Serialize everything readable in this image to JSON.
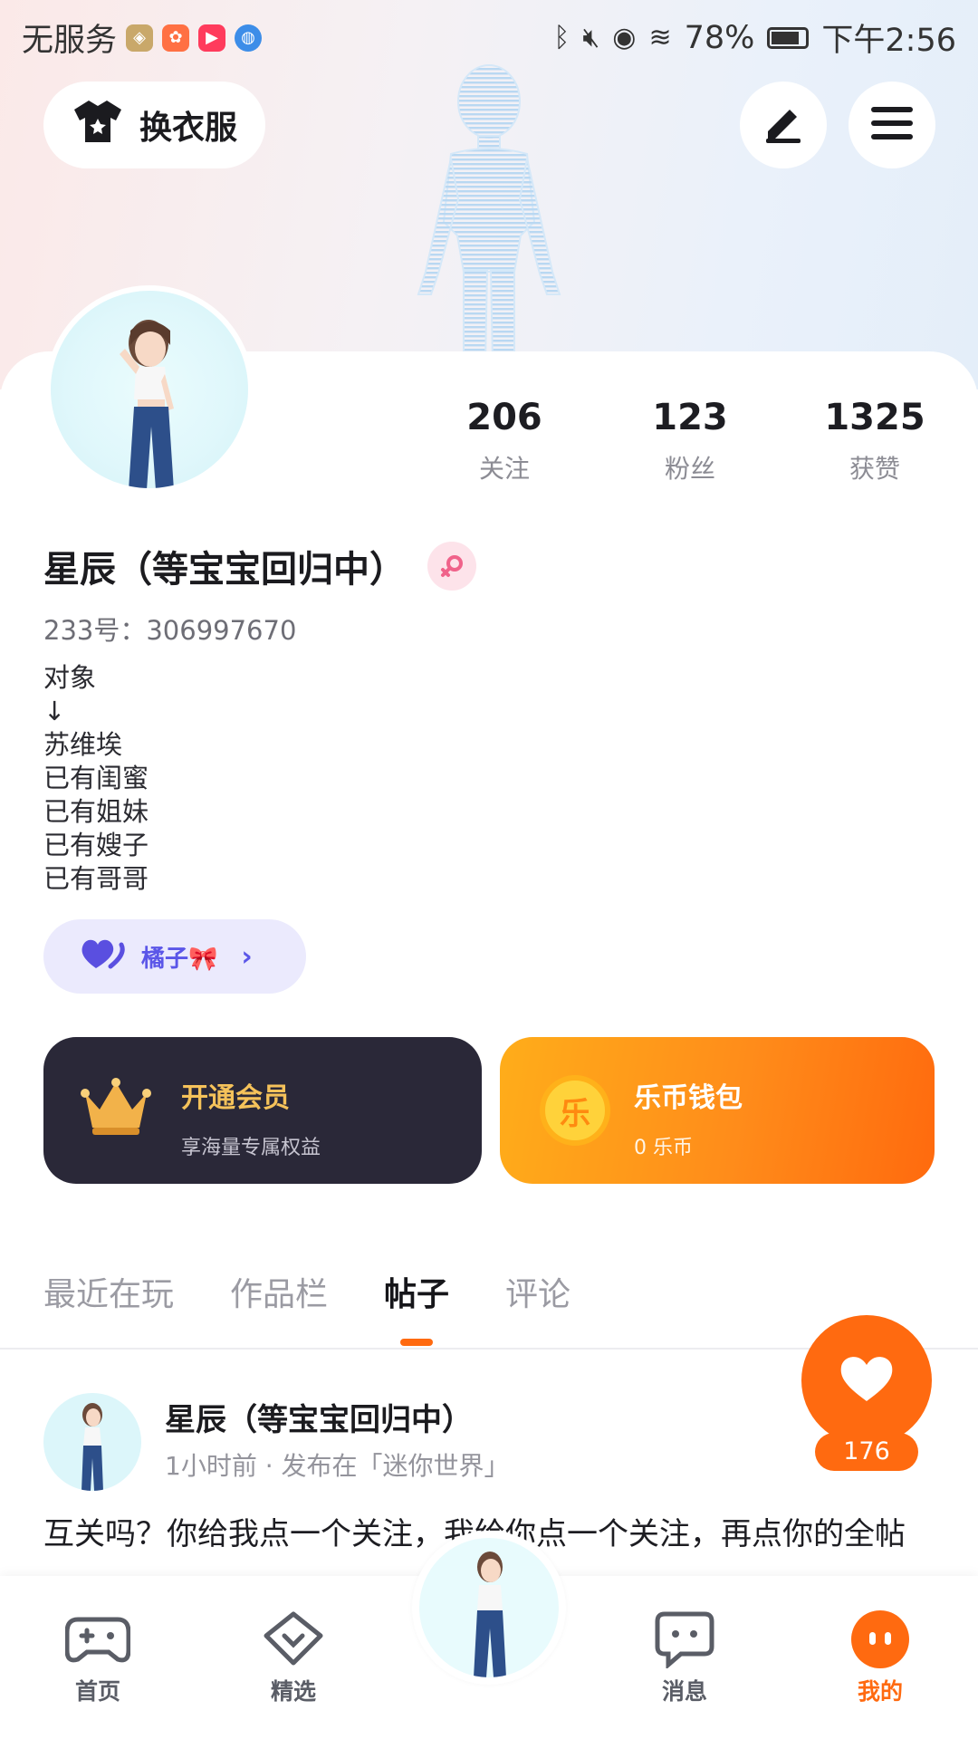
{
  "status_bar": {
    "carrier": "无服务",
    "battery": "78%",
    "time": "下午2:56"
  },
  "header": {
    "outfit_label": "换衣服",
    "edit_icon": "pen-icon",
    "menu_icon": "hamburger-icon"
  },
  "stats": [
    {
      "value": "206",
      "label": "关注"
    },
    {
      "value": "123",
      "label": "粉丝"
    },
    {
      "value": "1325",
      "label": "获赞"
    }
  ],
  "profile": {
    "name": "星辰（等宝宝回归中）",
    "uid": "233号：306997670",
    "bio": "对象\n↓\n苏维埃\n已有闺蜜\n已有姐妹\n已有嫂子\n已有哥哥",
    "relation_tag": "橘子🎀"
  },
  "vip_card": {
    "title": "开通会员",
    "subtitle": "享海量专属权益",
    "color": "#2a2838"
  },
  "wallet_card": {
    "icon_char": "乐",
    "title": "乐币钱包",
    "subtitle": "0 乐币",
    "color": "#ff8c1a"
  },
  "tabs": [
    {
      "label": "最近在玩"
    },
    {
      "label": "作品栏"
    },
    {
      "label": "帖子",
      "active": true
    },
    {
      "label": "评论"
    }
  ],
  "post": {
    "author": "星辰（等宝宝回归中）",
    "meta": "1小时前 · 发布在「迷你世界」",
    "text": "互关吗？你给我点一个关注，我给你点一个关注，再点你的全帖",
    "like_count": "176"
  },
  "bottom_nav": [
    {
      "label": "首页",
      "icon": "gamepad-icon"
    },
    {
      "label": "精选",
      "icon": "heart-chat-icon"
    },
    {
      "label": "消息",
      "icon": "message-icon"
    },
    {
      "label": "我的",
      "icon": "profile-face-icon",
      "active": true
    }
  ],
  "accent_color": "#ff6a10"
}
